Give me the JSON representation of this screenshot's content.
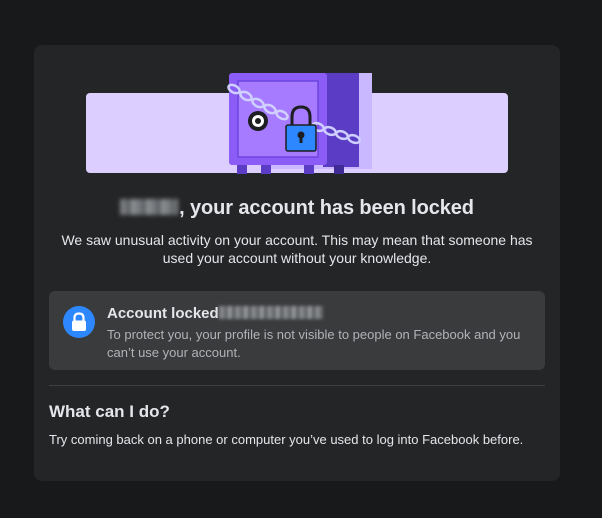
{
  "colors": {
    "page_background": "#18191a",
    "card_background": "#242526",
    "illustration_band": "#dccfff",
    "safe_purple": "#8b5cf6",
    "lock_accent": "#2d88ff",
    "primary_text": "#e4e6eb",
    "secondary_text": "#b0b3b8"
  },
  "header": {
    "title_suffix": ", your account has been locked",
    "description": "We saw unusual activity on your account. This may mean that someone has used your account without your knowledge."
  },
  "notice": {
    "icon": "lock-icon",
    "title": "Account locked",
    "body": "To protect you, your profile is not visible to people on Facebook and you can’t use your account."
  },
  "help": {
    "heading": "What can I do?",
    "text": "Try coming back on a phone or computer you’ve used to log into Facebook before."
  }
}
